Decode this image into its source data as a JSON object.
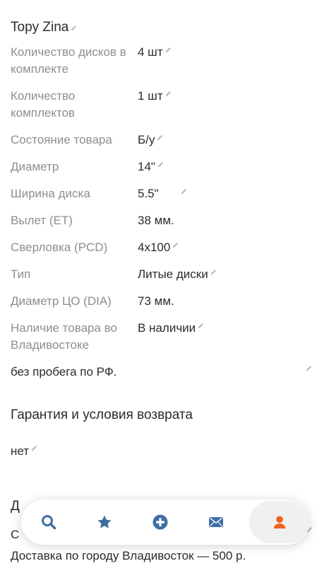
{
  "product": {
    "title": "Topy Zina"
  },
  "specs": [
    {
      "label": "Количество дисков в комплекте",
      "value": "4 шт"
    },
    {
      "label": "Количество комплектов",
      "value": "1 шт"
    },
    {
      "label": "Состояние товара",
      "value": "Б/у"
    },
    {
      "label": "Диаметр",
      "value": "14\""
    },
    {
      "label": "Ширина диска",
      "value": "5.5\""
    },
    {
      "label": "Вылет (ET)",
      "value": "38 мм."
    },
    {
      "label": "Сверловка (PCD)",
      "value": "4x100"
    },
    {
      "label": "Тип",
      "value": "Литые диски"
    },
    {
      "label": "Диаметр ЦО (DIA)",
      "value": "73 мм."
    },
    {
      "label": "Наличие товара во Владивостоке",
      "value": "В наличии"
    }
  ],
  "description": "без пробега по РФ.",
  "warranty": {
    "title": "Гарантия и условия возврата",
    "value": "нет"
  },
  "delivery": {
    "heading_partial": "Д",
    "line_partial": "С",
    "city_price": "Доставка по городу Владивосток — 500 р."
  },
  "tabbar": {
    "items": [
      {
        "name": "search",
        "icon": "search-icon"
      },
      {
        "name": "favorites",
        "icon": "star-icon"
      },
      {
        "name": "add",
        "icon": "plus-circle-icon"
      },
      {
        "name": "messages",
        "icon": "envelope-icon"
      },
      {
        "name": "profile",
        "icon": "user-icon",
        "active": true
      }
    ]
  },
  "colors": {
    "accent": "#f0611e",
    "icon_blue": "#3e6fa3",
    "label_gray": "#8e8e8e",
    "text": "#2b2b2b",
    "link": "#2f7fd6"
  }
}
